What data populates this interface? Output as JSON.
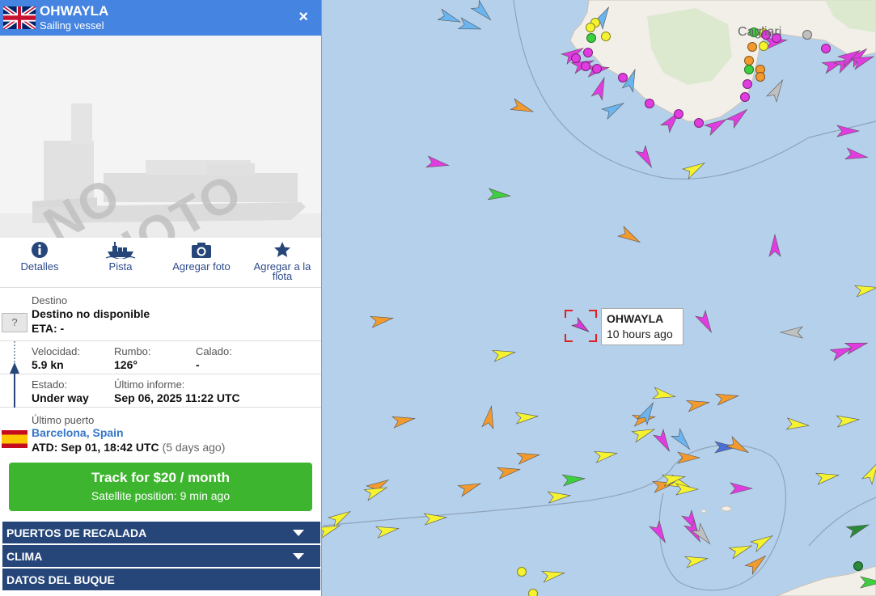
{
  "vessel": {
    "name": "OHWAYLA",
    "type": "Sailing vessel",
    "close_label": "×"
  },
  "photo": {
    "placeholder": "NO PHOTO"
  },
  "actions": [
    {
      "label": "Detalles",
      "icon": "info-icon"
    },
    {
      "label": "Pista",
      "icon": "ship-track-icon"
    },
    {
      "label": "Agregar foto",
      "icon": "camera-icon"
    },
    {
      "label": "Agregar a la flota",
      "icon": "star-icon"
    }
  ],
  "destination": {
    "label": "Destino",
    "value": "Destino no disponible",
    "eta": "ETA: -",
    "unknown_port": "?"
  },
  "stats": {
    "speed_label": "Velocidad:",
    "speed": "5.9 kn",
    "course_label": "Rumbo:",
    "course": "126°",
    "draught_label": "Calado:",
    "draught": "-",
    "status_label": "Estado:",
    "status": "Under way",
    "report_label": "Último informe:",
    "report": "Sep 06, 2025 11:22 UTC"
  },
  "last_port": {
    "label": "Último puerto",
    "name": "Barcelona, Spain",
    "atd": "ATD: Sep 01, 18:42 UTC",
    "ago": "(5 days ago)"
  },
  "track_button": {
    "title": "Track for $20 / month",
    "subtitle": "Satellite position: 9 min ago"
  },
  "sections": [
    {
      "label": "PUERTOS DE RECALADA"
    },
    {
      "label": "CLIMA"
    },
    {
      "label": "DATOS DEL BUQUE"
    }
  ],
  "map": {
    "city": "Cagliari",
    "tooltip": {
      "name": "OHWAYLA",
      "time": "10 hours ago"
    }
  },
  "colors": {
    "header": "#4584e0",
    "section": "#26467a",
    "track": "#3db52e",
    "sea": "#b5d0ea",
    "land": "#f2efe9"
  }
}
